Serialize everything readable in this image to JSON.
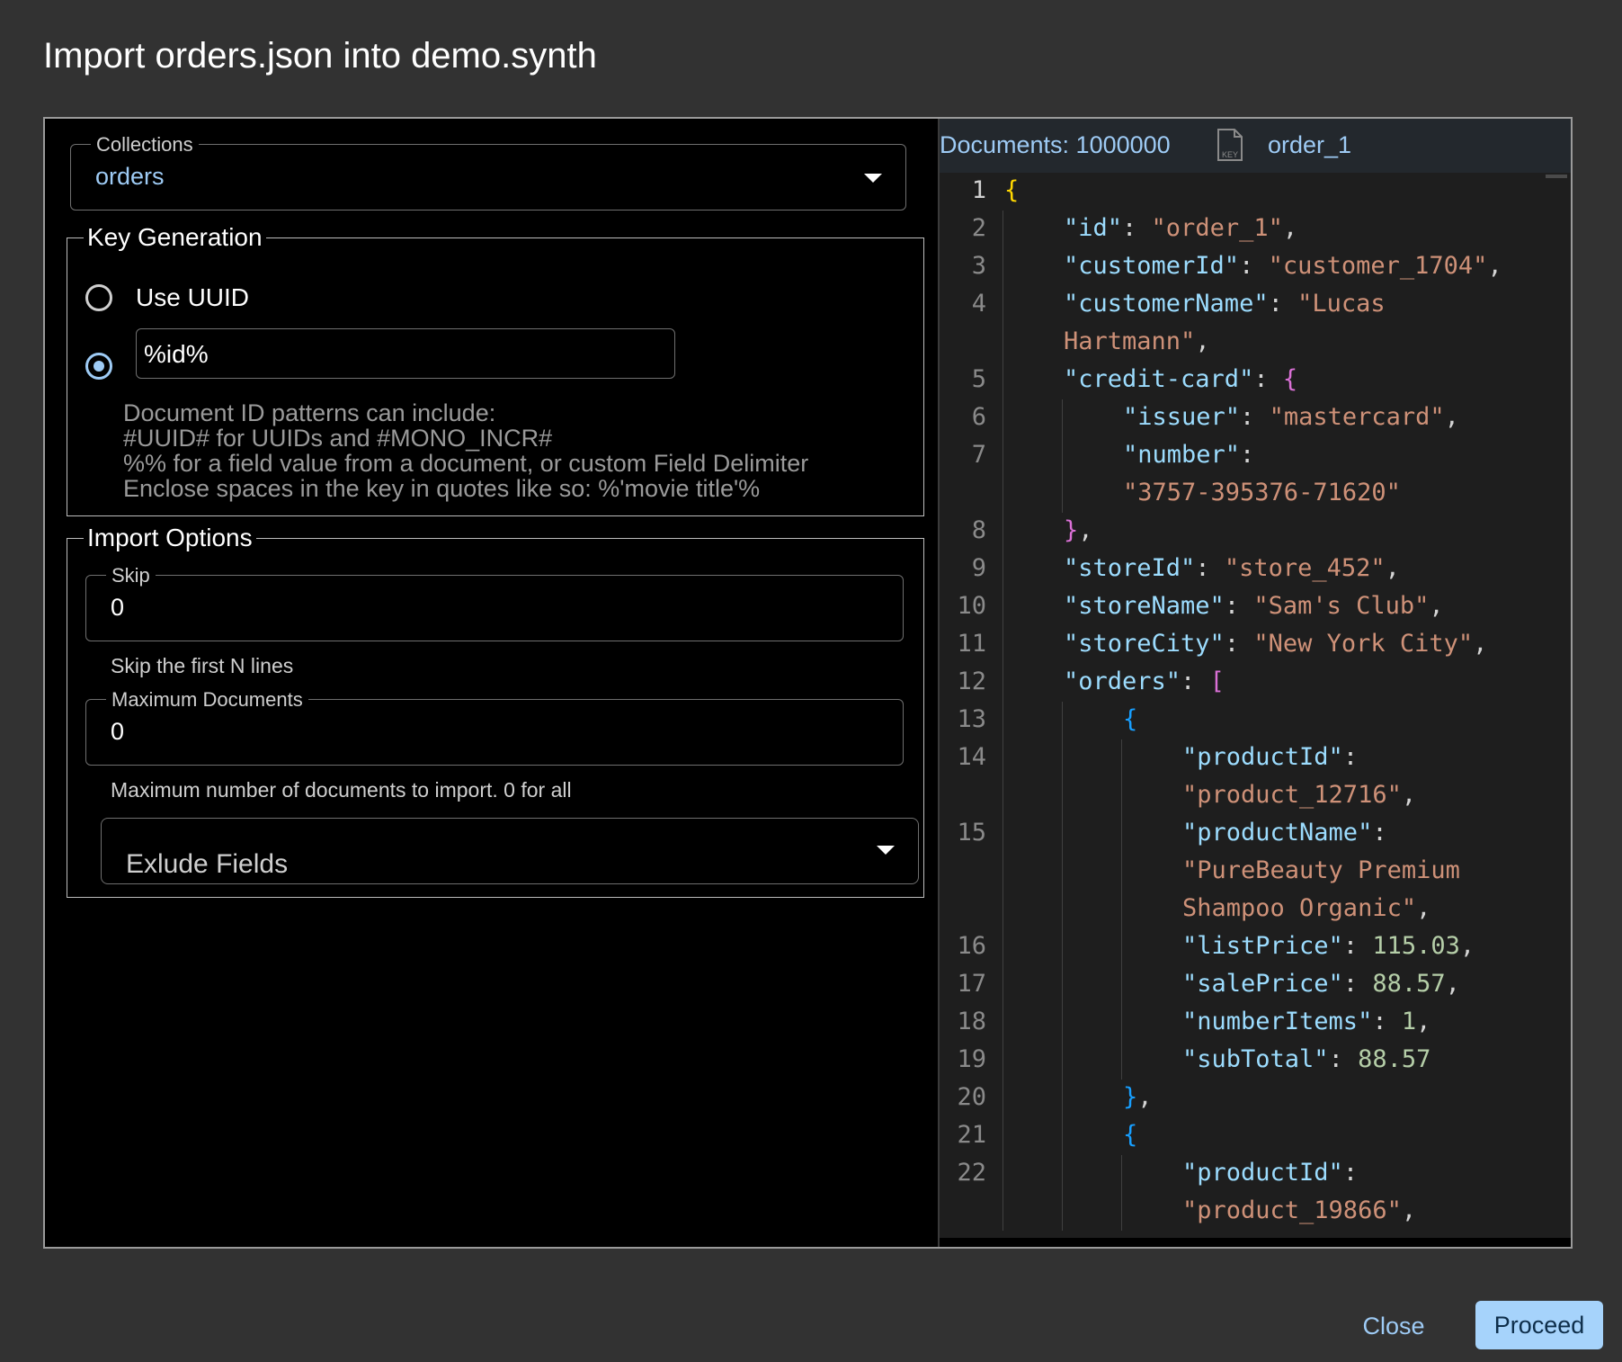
{
  "dialog": {
    "title": "Import orders.json into demo.synth"
  },
  "collections": {
    "label": "Collections",
    "value": "orders"
  },
  "key_generation": {
    "legend": "Key Generation",
    "uuid_label": "Use UUID",
    "pattern_value": "%id%",
    "hint_lines": [
      "Document ID patterns can include:",
      "#UUID# for UUIDs and #MONO_INCR#",
      "%% for a field value from a document, or custom Field Delimiter",
      "Enclose spaces in the key in quotes like so: %'movie title'%"
    ]
  },
  "import_options": {
    "legend": "Import Options",
    "skip_label": "Skip",
    "skip_value": "0",
    "skip_help": "Skip the first N lines",
    "max_label": "Maximum Documents",
    "max_value": "0",
    "max_help": "Maximum number of documents to import. 0 for all",
    "exclude_label": "Exlude Fields"
  },
  "preview": {
    "documents_label": "Documents: 1000000",
    "key_icon_text": "KEY",
    "current_key": "order_1",
    "lines": [
      {
        "n": "1",
        "indent": 0,
        "tokens": [
          [
            "b1",
            "{"
          ]
        ]
      },
      {
        "n": "2",
        "indent": 1,
        "tokens": [
          [
            "k",
            "\"id\""
          ],
          [
            "p",
            ": "
          ],
          [
            "s",
            "\"order_1\""
          ],
          [
            "p",
            ","
          ]
        ]
      },
      {
        "n": "3",
        "indent": 1,
        "tokens": [
          [
            "k",
            "\"customerId\""
          ],
          [
            "p",
            ": "
          ],
          [
            "s",
            "\"customer_1704\""
          ],
          [
            "p",
            ","
          ]
        ]
      },
      {
        "n": "4",
        "indent": 1,
        "tokens": [
          [
            "k",
            "\"customerName\""
          ],
          [
            "p",
            ": "
          ],
          [
            "s",
            "\"Lucas"
          ]
        ]
      },
      {
        "n": "",
        "indent": 1,
        "tokens": [
          [
            "s",
            "Hartmann\""
          ],
          [
            "p",
            ","
          ]
        ]
      },
      {
        "n": "5",
        "indent": 1,
        "tokens": [
          [
            "k",
            "\"credit-card\""
          ],
          [
            "p",
            ": "
          ],
          [
            "b2",
            "{"
          ]
        ]
      },
      {
        "n": "6",
        "indent": 2,
        "tokens": [
          [
            "k",
            "\"issuer\""
          ],
          [
            "p",
            ": "
          ],
          [
            "s",
            "\"mastercard\""
          ],
          [
            "p",
            ","
          ]
        ]
      },
      {
        "n": "7",
        "indent": 2,
        "tokens": [
          [
            "k",
            "\"number\""
          ],
          [
            "p",
            ":"
          ]
        ]
      },
      {
        "n": "",
        "indent": 2,
        "tokens": [
          [
            "s",
            "\"3757-395376-71620\""
          ]
        ]
      },
      {
        "n": "8",
        "indent": 1,
        "tokens": [
          [
            "b2",
            "}"
          ],
          [
            "p",
            ","
          ]
        ]
      },
      {
        "n": "9",
        "indent": 1,
        "tokens": [
          [
            "k",
            "\"storeId\""
          ],
          [
            "p",
            ": "
          ],
          [
            "s",
            "\"store_452\""
          ],
          [
            "p",
            ","
          ]
        ]
      },
      {
        "n": "10",
        "indent": 1,
        "tokens": [
          [
            "k",
            "\"storeName\""
          ],
          [
            "p",
            ": "
          ],
          [
            "s",
            "\"Sam's Club\""
          ],
          [
            "p",
            ","
          ]
        ]
      },
      {
        "n": "11",
        "indent": 1,
        "tokens": [
          [
            "k",
            "\"storeCity\""
          ],
          [
            "p",
            ": "
          ],
          [
            "s",
            "\"New York City\""
          ],
          [
            "p",
            ","
          ]
        ]
      },
      {
        "n": "12",
        "indent": 1,
        "tokens": [
          [
            "k",
            "\"orders\""
          ],
          [
            "p",
            ": "
          ],
          [
            "b2",
            "["
          ]
        ]
      },
      {
        "n": "13",
        "indent": 2,
        "tokens": [
          [
            "b3",
            "{"
          ]
        ]
      },
      {
        "n": "14",
        "indent": 3,
        "tokens": [
          [
            "k",
            "\"productId\""
          ],
          [
            "p",
            ":"
          ]
        ]
      },
      {
        "n": "",
        "indent": 3,
        "tokens": [
          [
            "s",
            "\"product_12716\""
          ],
          [
            "p",
            ","
          ]
        ]
      },
      {
        "n": "15",
        "indent": 3,
        "tokens": [
          [
            "k",
            "\"productName\""
          ],
          [
            "p",
            ":"
          ]
        ]
      },
      {
        "n": "",
        "indent": 3,
        "tokens": [
          [
            "s",
            "\"PureBeauty Premium"
          ]
        ]
      },
      {
        "n": "",
        "indent": 3,
        "tokens": [
          [
            "s",
            "Shampoo Organic\""
          ],
          [
            "p",
            ","
          ]
        ]
      },
      {
        "n": "16",
        "indent": 3,
        "tokens": [
          [
            "k",
            "\"listPrice\""
          ],
          [
            "p",
            ": "
          ],
          [
            "n",
            "115.03"
          ],
          [
            "p",
            ","
          ]
        ]
      },
      {
        "n": "17",
        "indent": 3,
        "tokens": [
          [
            "k",
            "\"salePrice\""
          ],
          [
            "p",
            ": "
          ],
          [
            "n",
            "88.57"
          ],
          [
            "p",
            ","
          ]
        ]
      },
      {
        "n": "18",
        "indent": 3,
        "tokens": [
          [
            "k",
            "\"numberItems\""
          ],
          [
            "p",
            ": "
          ],
          [
            "n",
            "1"
          ],
          [
            "p",
            ","
          ]
        ]
      },
      {
        "n": "19",
        "indent": 3,
        "tokens": [
          [
            "k",
            "\"subTotal\""
          ],
          [
            "p",
            ": "
          ],
          [
            "n",
            "88.57"
          ]
        ]
      },
      {
        "n": "20",
        "indent": 2,
        "tokens": [
          [
            "b3",
            "}"
          ],
          [
            "p",
            ","
          ]
        ]
      },
      {
        "n": "21",
        "indent": 2,
        "tokens": [
          [
            "b3",
            "{"
          ]
        ]
      },
      {
        "n": "22",
        "indent": 3,
        "tokens": [
          [
            "k",
            "\"productId\""
          ],
          [
            "p",
            ":"
          ]
        ]
      },
      {
        "n": "",
        "indent": 3,
        "tokens": [
          [
            "s",
            "\"product_19866\""
          ],
          [
            "p",
            ","
          ]
        ]
      }
    ]
  },
  "actions": {
    "close_label": "Close",
    "proceed_label": "Proceed"
  },
  "colors": {
    "accent": "#9ecbf5",
    "proceed_bg": "#a6d3fb",
    "dialog_bg": "#323232",
    "editor_bg": "#1e1e1e"
  }
}
